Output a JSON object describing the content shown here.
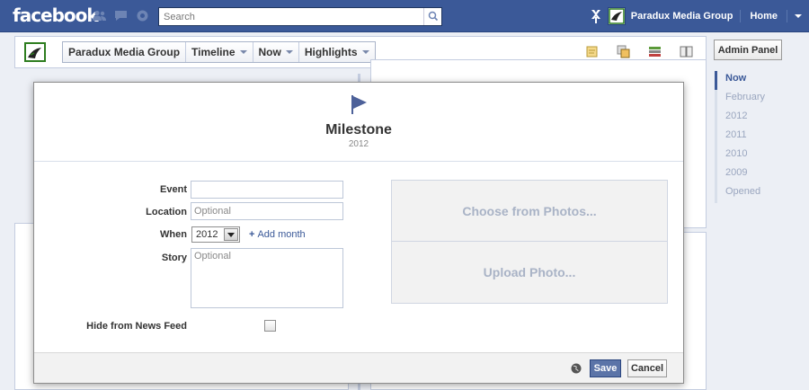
{
  "topbar": {
    "logo": "facebook",
    "search_placeholder": "Search",
    "page_name": "Paradux Media Group",
    "home_label": "Home",
    "brand_color": "#3b5998"
  },
  "timeline_header": {
    "nav": [
      {
        "label": "Paradux Media Group"
      },
      {
        "label": "Timeline"
      },
      {
        "label": "Now"
      },
      {
        "label": "Highlights"
      }
    ],
    "admin_panel_label": "Admin Panel"
  },
  "scrubber": {
    "items": [
      {
        "label": "Now"
      },
      {
        "label": "February"
      },
      {
        "label": "2012"
      },
      {
        "label": "2011"
      },
      {
        "label": "2010"
      },
      {
        "label": "2009"
      },
      {
        "label": "Opened"
      }
    ]
  },
  "dialog": {
    "title": "Milestone",
    "year": "2012",
    "labels": {
      "event": "Event",
      "location": "Location",
      "when": "When",
      "story": "Story",
      "hide_from_feed": "Hide from News Feed"
    },
    "event_value": "",
    "location_placeholder": "Optional",
    "when_year": "2012",
    "add_month": "Add month",
    "story_placeholder": "Optional",
    "hide_from_feed_checked": false,
    "choose_from_photos": "Choose from Photos...",
    "upload_photo": "Upload Photo...",
    "save_label": "Save",
    "cancel_label": "Cancel"
  }
}
